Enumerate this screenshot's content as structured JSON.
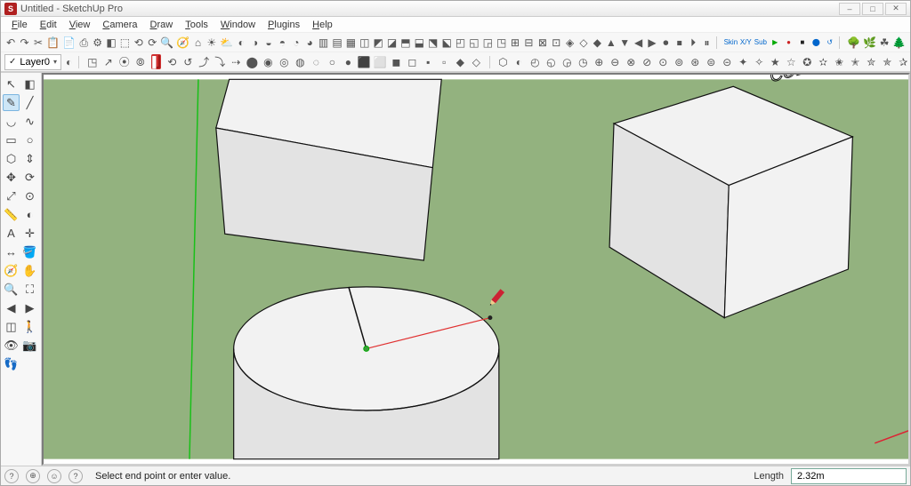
{
  "app": {
    "title": "Untitled - SketchUp Pro",
    "icon_letter": "S"
  },
  "window_controls": {
    "min": "–",
    "max": "□",
    "close": "✕"
  },
  "menu": [
    "File",
    "Edit",
    "View",
    "Camera",
    "Draw",
    "Tools",
    "Window",
    "Plugins",
    "Help"
  ],
  "layer": {
    "name": "Layer0",
    "checked": "✓"
  },
  "icons": {
    "row1": [
      "↶",
      "↷",
      "✂",
      "📋",
      "📄",
      "⎙",
      "⚙",
      "◧",
      "⬚",
      "⟲",
      "⟳",
      "🔍",
      "🧭",
      "⌂",
      "☀",
      "⛅",
      "◐",
      "◑",
      "◒",
      "◓",
      "◔",
      "◕",
      "▥",
      "▤",
      "▦",
      "◫",
      "◩",
      "◪",
      "⬒",
      "⬓",
      "⬔",
      "⬕",
      "◰",
      "◱",
      "◲",
      "◳",
      "⊞",
      "⊟",
      "⊠",
      "⊡",
      "◈",
      "◇",
      "◆",
      "▲",
      "▼",
      "◀",
      "▶",
      "⏺",
      "⏹",
      "⏵",
      "⏸"
    ],
    "row1b": [
      "Skin",
      "X/Y",
      "Sub",
      "▶",
      "●",
      "■",
      "⬤",
      "↺"
    ],
    "row1c": [
      "🌳",
      "🌿",
      "☘",
      "🌲"
    ],
    "row2_before": [
      "◳",
      "↗",
      "⦿",
      "⦾"
    ],
    "row2_after": [
      "⟲",
      "↺",
      "⤴",
      "⤵",
      "⇢",
      "⬤",
      "◉",
      "◎",
      "◍",
      "◌",
      "○",
      "●",
      "⬛",
      "⬜",
      "◼",
      "◻",
      "▪",
      "▫",
      "◆",
      "◇"
    ],
    "row2_more": [
      "⬡",
      "◐",
      "◴",
      "◵",
      "◶",
      "◷",
      "⊕",
      "⊖",
      "⊗",
      "⊘",
      "⊙",
      "⊚",
      "⊛",
      "⊜",
      "⊝",
      "✦",
      "✧",
      "★",
      "☆",
      "✪",
      "✫",
      "✬",
      "✭",
      "✮",
      "✯",
      "✰"
    ]
  },
  "left_tools": [
    {
      "name": "select",
      "glyph": "↖"
    },
    {
      "name": "eraser",
      "glyph": "◧"
    },
    {
      "name": "pencil",
      "glyph": "✎",
      "selected": true
    },
    {
      "name": "line",
      "glyph": "╱"
    },
    {
      "name": "arc",
      "glyph": "◡"
    },
    {
      "name": "freehand",
      "glyph": "∿"
    },
    {
      "name": "rectangle",
      "glyph": "▭"
    },
    {
      "name": "circle",
      "glyph": "○"
    },
    {
      "name": "polygon",
      "glyph": "⬡"
    },
    {
      "name": "pushpull",
      "glyph": "⇕"
    },
    {
      "name": "move",
      "glyph": "✥"
    },
    {
      "name": "rotate",
      "glyph": "⟳"
    },
    {
      "name": "scale",
      "glyph": "⤢"
    },
    {
      "name": "offset",
      "glyph": "⊙"
    },
    {
      "name": "tape",
      "glyph": "📏"
    },
    {
      "name": "protractor",
      "glyph": "◐"
    },
    {
      "name": "text",
      "glyph": "A"
    },
    {
      "name": "axes",
      "glyph": "✛"
    },
    {
      "name": "dimension",
      "glyph": "↔"
    },
    {
      "name": "paint",
      "glyph": "🪣"
    },
    {
      "name": "orbit",
      "glyph": "🧭"
    },
    {
      "name": "pan",
      "glyph": "✋"
    },
    {
      "name": "zoom",
      "glyph": "🔍"
    },
    {
      "name": "zoomext",
      "glyph": "⛶"
    },
    {
      "name": "prev",
      "glyph": "◀"
    },
    {
      "name": "next",
      "glyph": "▶"
    },
    {
      "name": "section",
      "glyph": "◫"
    },
    {
      "name": "walk",
      "glyph": "🚶"
    },
    {
      "name": "look",
      "glyph": "👁"
    },
    {
      "name": "position",
      "glyph": "📷"
    },
    {
      "name": "footprints",
      "glyph": "👣"
    },
    {
      "name": "misc",
      "glyph": ""
    }
  ],
  "scene": {
    "ground": "#93b27f",
    "cube_label": "CUBE",
    "face_light": "#f2f2f2",
    "face_mid": "#e3e3e3",
    "face_dark": "#d0d0d0",
    "stroke": "#111"
  },
  "status": {
    "prompt": "Select end point or enter value.",
    "length_label": "Length",
    "length_value": "2.32m"
  }
}
